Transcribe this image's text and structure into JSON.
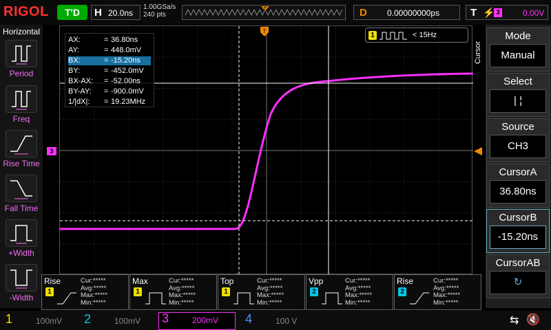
{
  "brand": {
    "logo": "RIGOL"
  },
  "trigger_state": "T'D",
  "horizontal": {
    "letter": "H",
    "timebase": "20.0ns",
    "sample_rate": "1.00GSa/s",
    "points": "240  pts"
  },
  "delay": {
    "letter": "D",
    "value": "0.00000000ps"
  },
  "trigger": {
    "letter": "T",
    "channel": "3",
    "level": "0.00V"
  },
  "trigger_pos_marker": "T",
  "left_panel": {
    "title": "Horizontal",
    "items": [
      {
        "label": "Period",
        "icon": "period-icon"
      },
      {
        "label": "Freq",
        "icon": "freq-icon"
      },
      {
        "label": "Rise Time",
        "icon": "rise-time-icon"
      },
      {
        "label": "Fall Time",
        "icon": "fall-time-icon"
      },
      {
        "label": "+Width",
        "icon": "pos-width-icon"
      },
      {
        "label": "-Width",
        "icon": "neg-width-icon"
      }
    ]
  },
  "cursor_info": {
    "rows": [
      {
        "key": "AX:",
        "eq": "=",
        "val": "36.80ns"
      },
      {
        "key": "AY:",
        "eq": "=",
        "val": "448.0mV"
      },
      {
        "key": "BX:",
        "eq": "=",
        "val": "-15.20ns"
      },
      {
        "key": "BY:",
        "eq": "=",
        "val": "-452.0mV"
      },
      {
        "key": "BX-AX:",
        "eq": "=",
        "val": "-52.00ns"
      },
      {
        "key": "BY-AY:",
        "eq": "=",
        "val": "-900.0mV"
      },
      {
        "key": "1/|dX|:",
        "eq": "=",
        "val": "19.23MHz"
      }
    ]
  },
  "freq_counter": {
    "channel": "1",
    "value": "< 15Hz"
  },
  "ch3_marker": "3",
  "right_panel": {
    "vertical_title": "Cursor",
    "items": [
      {
        "title": "Mode",
        "value": "Manual"
      },
      {
        "title": "Select",
        "value": "|   ¦"
      },
      {
        "title": "Source",
        "value": "CH3"
      },
      {
        "title": "CursorA",
        "value": "36.80ns"
      },
      {
        "title": "CursorB",
        "value": "-15.20ns"
      },
      {
        "title": "CursorAB",
        "value": ""
      }
    ]
  },
  "measurements": [
    {
      "name": "Rise",
      "channel": "1",
      "lines": [
        "Cur:*****",
        "Avg:*****",
        "Max:*****",
        "Min:*****"
      ]
    },
    {
      "name": "Max",
      "channel": "1",
      "lines": [
        "Cur:*****",
        "Avg:*****",
        "Max:*****",
        "Min:*****"
      ]
    },
    {
      "name": "Top",
      "channel": "1",
      "lines": [
        "Cur:*****",
        "Avg:*****",
        "Max:*****",
        "Min:*****"
      ]
    },
    {
      "name": "Vpp",
      "channel": "2",
      "lines": [
        "Cur:*****",
        "Avg:*****",
        "Max:*****",
        "Min:*****"
      ]
    },
    {
      "name": "Rise",
      "channel": "2",
      "lines": [
        "Cur:*****",
        "Avg:*****",
        "Max:*****",
        "Min:*****"
      ]
    }
  ],
  "channels": [
    {
      "num": "1",
      "scale": "100mV",
      "color": "#f0e000"
    },
    {
      "num": "2",
      "scale": "100mV",
      "color": "#00c8e8"
    },
    {
      "num": "3",
      "scale": "200mV",
      "color": "#ff2fff"
    },
    {
      "num": "4",
      "scale": "100 V",
      "color": "#4a90ff"
    }
  ],
  "colors": {
    "ch1": "#f0e000",
    "ch2": "#00c8e8",
    "ch3": "#ff2fff",
    "delay": "#f08a00",
    "trigger": "#f08a00"
  }
}
